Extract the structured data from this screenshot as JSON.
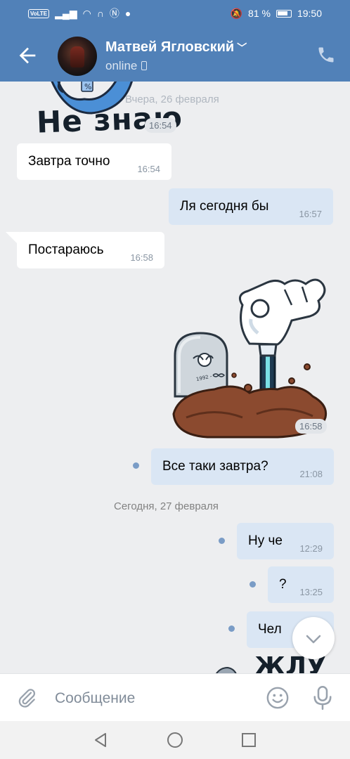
{
  "status_bar": {
    "volte": "VoLTE",
    "battery": "81 %",
    "time": "19:50"
  },
  "header": {
    "name": "Матвей Ягловский",
    "status": "online"
  },
  "chat": {
    "top_sticker_text": "Не знаю",
    "date_yesterday": "Вчера, 26 февраля",
    "date_today": "Сегодня, 27 февраля",
    "messages": [
      {
        "text": "",
        "time": "16:54"
      },
      {
        "text": "Завтра точно",
        "time": "16:54"
      },
      {
        "text": "Ля сегодня бы",
        "time": "16:57"
      },
      {
        "text": "Постараюсь",
        "time": "16:58"
      },
      {
        "text": "",
        "time": "16:58"
      },
      {
        "text": "Все таки завтра?",
        "time": "21:08"
      },
      {
        "text": "Ну че",
        "time": "12:29"
      },
      {
        "text": "?",
        "time": "13:25"
      },
      {
        "text": "Чел",
        "time": ""
      }
    ],
    "bottom_sticker_text": "ЖЛУ"
  },
  "input": {
    "placeholder": "Сообщение"
  },
  "colors": {
    "accent": "#5181b8",
    "outgoing": "#dae6f4",
    "background": "#edeef0"
  }
}
